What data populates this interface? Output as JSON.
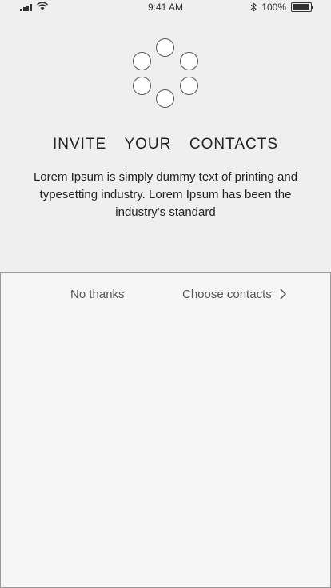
{
  "status_bar": {
    "time": "9:41 AM",
    "battery": "100%",
    "icons": [
      "signal-icon",
      "wifi-icon",
      "bluetooth-icon",
      "battery-icon"
    ]
  },
  "invite": {
    "title": "INVITE  YOUR  CONTACTS",
    "description": "Lorem Ipsum is simply dummy text of printing and typesetting industry. Lorem Ipsum has been the industry's standard"
  },
  "actions": {
    "no_thanks": "No thanks",
    "choose_contacts": "Choose contacts",
    "choose_icon": "chevron-right-icon"
  }
}
